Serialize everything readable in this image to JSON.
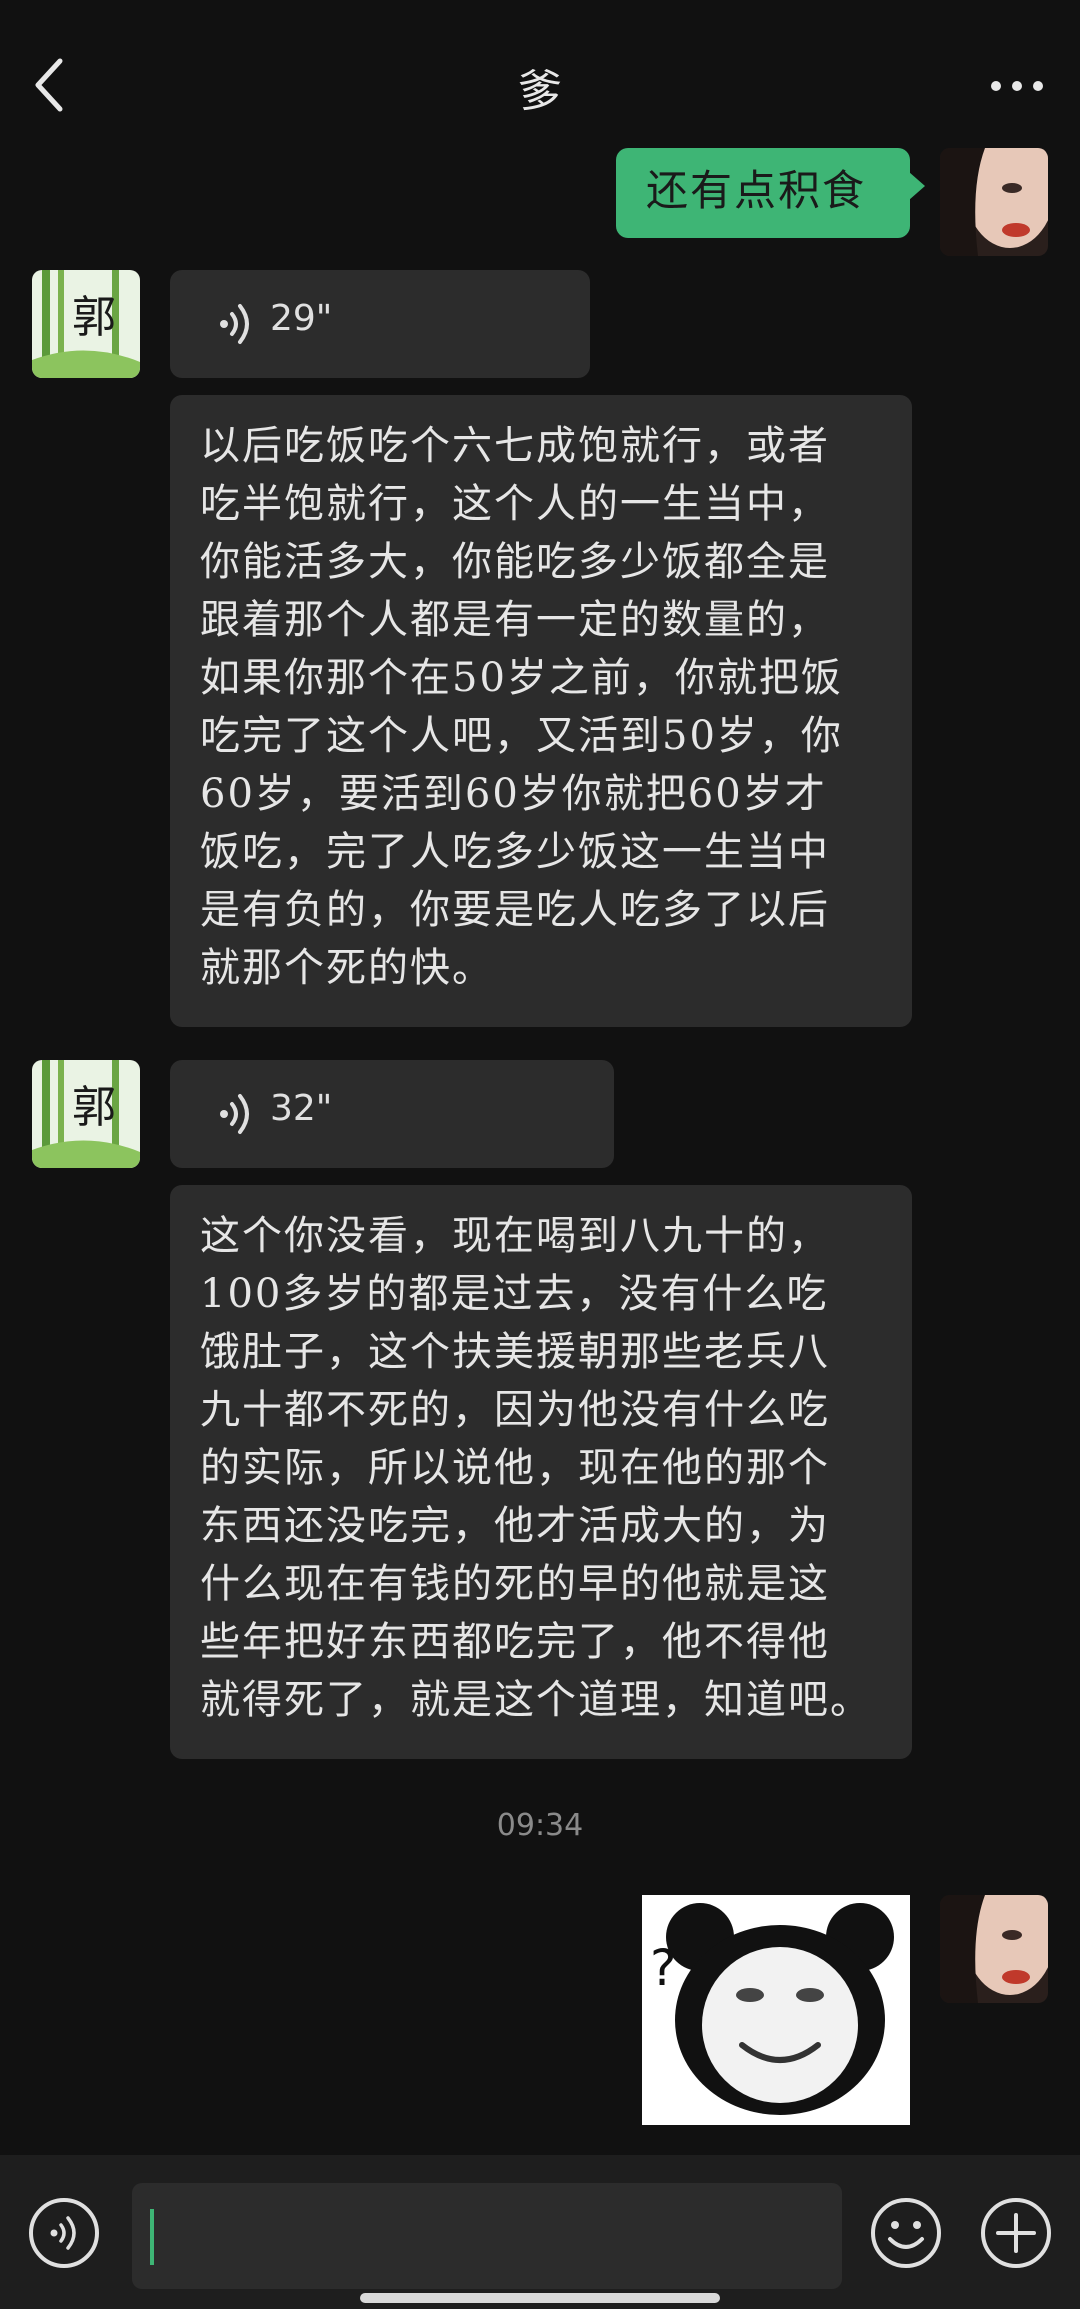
{
  "header": {
    "title": "爹",
    "back_icon": "chevron-left-icon",
    "more_icon": "more-dots-icon"
  },
  "messages": [
    {
      "from": "me",
      "type": "text",
      "text": "还有点积食"
    },
    {
      "from": "dad",
      "type": "voice",
      "duration": "29\""
    },
    {
      "from": "dad",
      "type": "text",
      "lines": [
        "以后吃饭吃个六七成饱就行，或者",
        "吃半饱就行，这个人的一生当中，",
        "你能活多大，你能吃多少饭都全是",
        "跟着那个人都是有一定的数量的，",
        "如果你那个在50岁之前，你就把饭",
        "吃完了这个人吧，又活到50岁，你",
        "60岁，要活到60岁你就把60岁才",
        "饭吃，完了人吃多少饭这一生当中",
        "是有负的，你要是吃人吃多了以后",
        "就那个死的快。"
      ]
    },
    {
      "from": "dad",
      "type": "voice",
      "duration": "32\""
    },
    {
      "from": "dad",
      "type": "text",
      "lines": [
        "这个你没看，现在喝到八九十的，",
        "100多岁的都是过去，没有什么吃",
        "饿肚子，这个扶美援朝那些老兵八",
        "九十都不死的，因为他没有什么吃",
        "的实际，所以说他，现在他的那个",
        "东西还没吃完，他才活成大的，为",
        "什么现在有钱的死的早的他就是这",
        "些年把好东西都吃完了，他不得他",
        "就得死了，就是这个道理，知道吧。"
      ]
    },
    {
      "type": "timestamp",
      "text": "09:34"
    },
    {
      "from": "me",
      "type": "sticker",
      "sticker": "panda-meme-question-sticker"
    }
  ],
  "input_bar": {
    "voice_icon": "voice-mode-icon",
    "text_value": "",
    "emoji_icon": "smiley-icon",
    "plus_icon": "plus-icon"
  },
  "colors": {
    "background": "#111111",
    "bubble_other": "#2c2c2c",
    "bubble_self": "#3eb575",
    "bottom_bar": "#1e1e1e"
  }
}
